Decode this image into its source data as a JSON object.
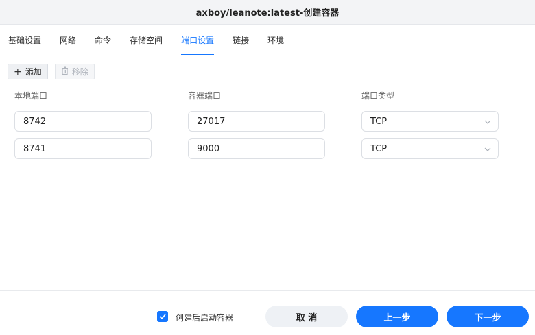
{
  "window": {
    "title": "axboy/leanote:latest-创建容器"
  },
  "tabs": [
    {
      "label": "基础设置",
      "active": false
    },
    {
      "label": "网络",
      "active": false
    },
    {
      "label": "命令",
      "active": false
    },
    {
      "label": "存储空间",
      "active": false
    },
    {
      "label": "端口设置",
      "active": true
    },
    {
      "label": "链接",
      "active": false
    },
    {
      "label": "环境",
      "active": false
    }
  ],
  "toolbar": {
    "add_label": "添加",
    "remove_label": "移除"
  },
  "columns": {
    "local_port": "本地端口",
    "container_port": "容器端口",
    "port_type": "端口类型"
  },
  "rows": [
    {
      "local_port": "8742",
      "container_port": "27017",
      "port_type": "TCP"
    },
    {
      "local_port": "8741",
      "container_port": "9000",
      "port_type": "TCP"
    }
  ],
  "footer": {
    "start_after_create_label": "创建后启动容器",
    "start_after_create_checked": true,
    "cancel_label": "取 消",
    "prev_label": "上一步",
    "next_label": "下一步"
  },
  "colors": {
    "accent": "#1677ff"
  }
}
